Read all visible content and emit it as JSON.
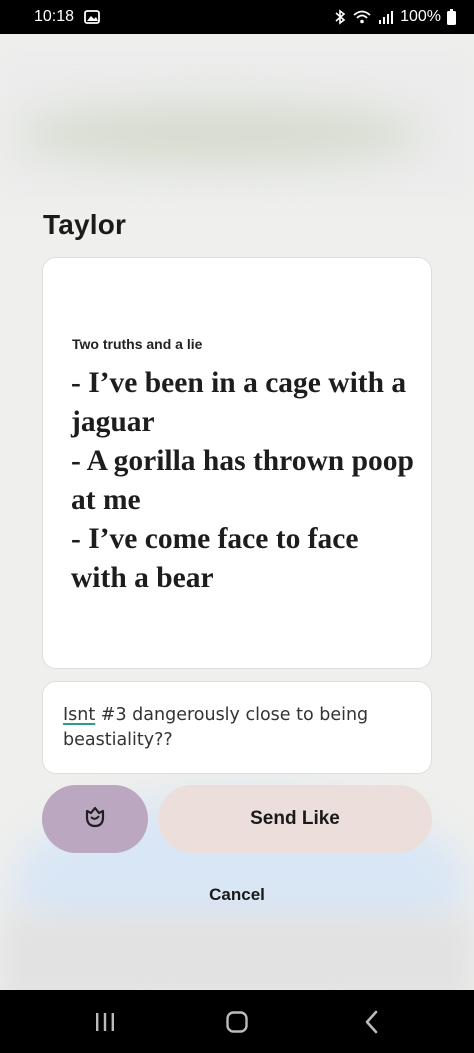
{
  "status_bar": {
    "time": "10:18",
    "battery": "100%",
    "icons": [
      "gallery-icon",
      "bluetooth-icon",
      "wifi-icon",
      "signal-icon",
      "battery-icon"
    ]
  },
  "profile": {
    "name": "Taylor"
  },
  "prompt": {
    "question": "Two truths and a lie",
    "answer": "- I’ve been in a cage with a jaguar\n- A gorilla has thrown poop at me\n- I’ve come face to face with a bear"
  },
  "comment": {
    "misspelled_word": "Isnt",
    "rest": " #3 dangerously close to being beastiality??"
  },
  "actions": {
    "rose_icon": "rose-icon",
    "send_label": "Send Like",
    "cancel_label": "Cancel"
  },
  "nav": {
    "icons": [
      "recent-apps-icon",
      "home-icon",
      "back-icon"
    ]
  },
  "colors": {
    "rose_button": "#bca7c0",
    "send_button": "#ecdfdb",
    "spellcheck_underline": "#2a9d8f"
  }
}
